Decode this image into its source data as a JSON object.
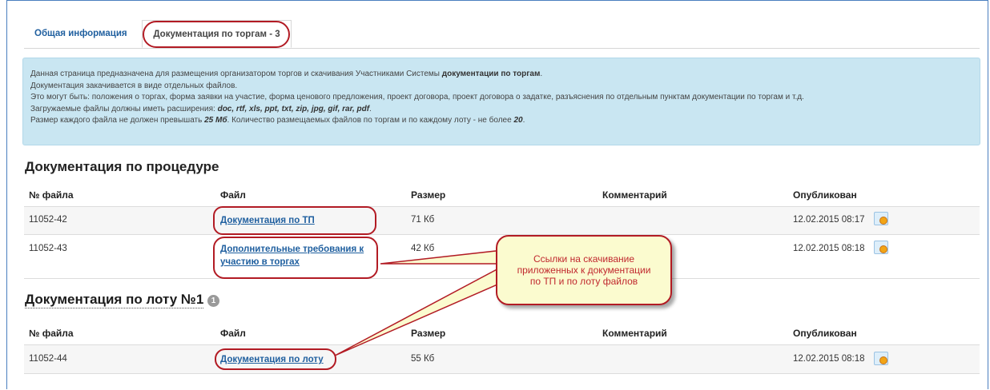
{
  "tabs": {
    "general": "Общая информация",
    "docs": "Документация по торгам - 3"
  },
  "info": {
    "l1_a": "Данная страница предназначена для размещения организатором торгов и скачивания Участниками Системы ",
    "l1_b": "документации по торгам",
    "l1_c": ".",
    "l2": "Документация закачивается в виде отдельных файлов.",
    "l3": "Это могут быть: положения о торгах, форма заявки на участие, форма ценового предложения, проект договора, проект договора о задатке, разъяснения по отдельным пунктам документации по торгам и т.д.",
    "l4_a": "Загружаемые файлы должны иметь расширения: ",
    "l4_b": "doc, rtf, xls, ppt, txt, zip, jpg, gif, rar, pdf",
    "l4_c": ".",
    "l5_a": "Размер каждого файла не должен превышать ",
    "l5_b": "25 Мб",
    "l5_c": ". Количество размещаемых файлов по торгам и по каждому лоту - не более ",
    "l5_d": "20",
    "l5_e": "."
  },
  "procedure": {
    "title": "Документация по процедуре",
    "columns": [
      "№ файла",
      "Файл",
      "Размер",
      "Комментарий",
      "Опубликован"
    ],
    "rows": [
      {
        "num": "11052-42",
        "file": "Документация по ТП",
        "size": "71 Кб",
        "comment": "",
        "published": "12.02.2015 08:17"
      },
      {
        "num": "11052-43",
        "file_l1": "Дополнительные требования к",
        "file_l2": "участию в торгах",
        "size": "42 Кб",
        "comment": "",
        "published": "12.02.2015 08:18"
      }
    ]
  },
  "lot": {
    "title": "Документация по лоту №1",
    "badge": "1",
    "columns": [
      "№ файла",
      "Файл",
      "Размер",
      "Комментарий",
      "Опубликован"
    ],
    "rows": [
      {
        "num": "11052-44",
        "file": "Документация по лоту",
        "size": "55 Кб",
        "comment": "",
        "published": "12.02.2015 08:18"
      }
    ]
  },
  "callout": {
    "l1": "Ссылки на скачивание",
    "l2": "приложенных к документации",
    "l3": "по ТП и по лоту файлов"
  },
  "colors": {
    "accent_red": "#b21b24",
    "link_blue": "#1f5f9f",
    "info_bg": "#c9e6f2",
    "callout_bg": "#fbfbcf"
  },
  "icons": [
    "certificate-icon"
  ]
}
